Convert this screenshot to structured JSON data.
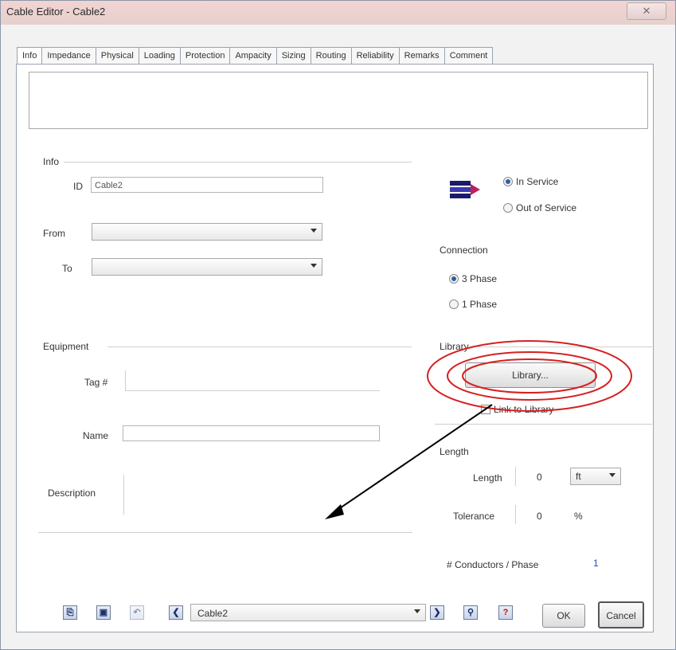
{
  "window": {
    "title": "Cable Editor - Cable2",
    "close_glyph": "✕"
  },
  "tabs": [
    "Info",
    "Impedance",
    "Physical",
    "Loading",
    "Protection",
    "Ampacity",
    "Sizing",
    "Routing",
    "Reliability",
    "Remarks",
    "Comment"
  ],
  "info": {
    "group_label": "Info",
    "id_label": "ID",
    "id_value": "Cable2",
    "from_label": "From",
    "to_label": "To"
  },
  "service": {
    "in_service": "In Service",
    "out_of_service": "Out of Service",
    "icon": "cable-icon"
  },
  "connection": {
    "group_label": "Connection",
    "option1": "3 Phase",
    "option2": "1 Phase"
  },
  "library": {
    "group_label": "Library",
    "button": "Library...",
    "link_checkbox": "Link to Library"
  },
  "equipment": {
    "group_label": "Equipment",
    "tag_label": "Tag #",
    "name_label": "Name",
    "description_label": "Description"
  },
  "length": {
    "group_label": "Length",
    "length_label": "Length",
    "length_value": "0",
    "unit": "ft",
    "tolerance_label": "Tolerance",
    "tolerance_value": "0",
    "percent": "%"
  },
  "conductors": {
    "label": "# Conductors / Phase",
    "value": "1"
  },
  "footer": {
    "nav_value": "Cable2",
    "ok": "OK",
    "cancel": "Cancel"
  },
  "colors": {
    "annotation_red": "#d62020",
    "arrow": "#000000"
  }
}
